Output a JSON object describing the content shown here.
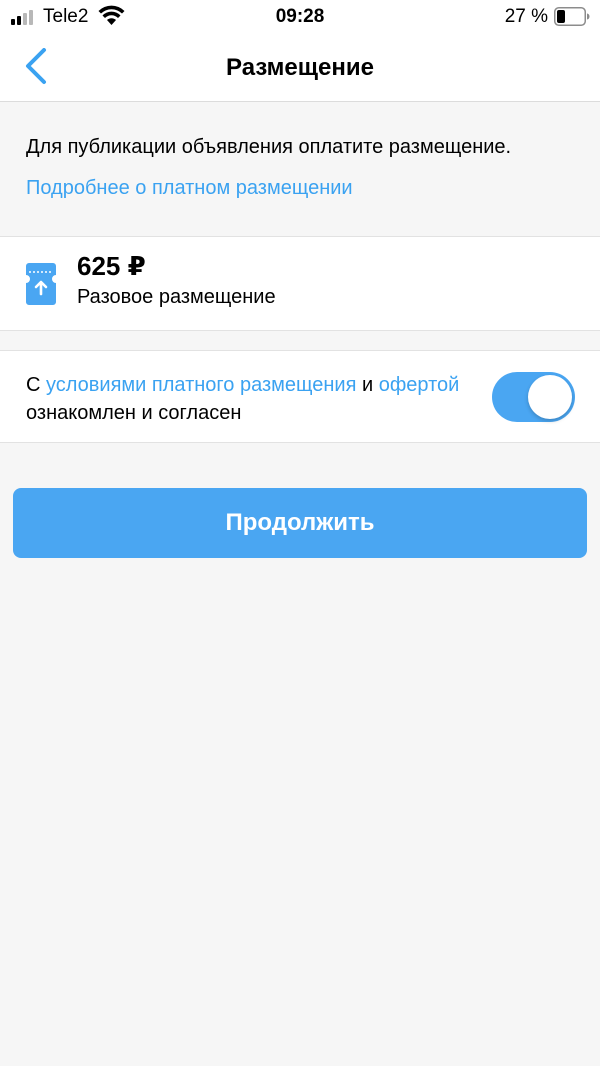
{
  "status_bar": {
    "carrier": "Tele2",
    "time": "09:28",
    "battery_percent": "27 %",
    "battery_level": 0.27
  },
  "nav": {
    "title": "Размещение",
    "back_icon": "chevron-left-icon"
  },
  "info": {
    "text": "Для публикации объявления оплатите размещение.",
    "link": "Подробнее о платном размещении"
  },
  "offer": {
    "icon": "ticket-icon",
    "price": "625 ₽",
    "description": "Разовое размещение"
  },
  "agreement": {
    "prefix": "С ",
    "terms_link": "условиями платного размещения",
    "and": " и ",
    "offer_link": "офертой",
    "suffix": " ознакомлен и согласен",
    "toggle_on": true
  },
  "continue_button": "Продолжить",
  "colors": {
    "accent": "#4aa6f2",
    "link": "#3aa2f1",
    "background": "#f6f6f6"
  }
}
